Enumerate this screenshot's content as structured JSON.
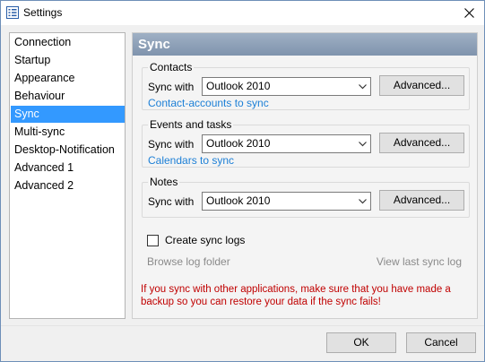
{
  "window": {
    "title": "Settings"
  },
  "nav": {
    "items": [
      {
        "label": "Connection"
      },
      {
        "label": "Startup"
      },
      {
        "label": "Appearance"
      },
      {
        "label": "Behaviour"
      },
      {
        "label": "Sync",
        "selected": true
      },
      {
        "label": "Multi-sync"
      },
      {
        "label": "Desktop-Notification"
      },
      {
        "label": "Advanced 1"
      },
      {
        "label": "Advanced 2"
      }
    ]
  },
  "panel": {
    "title": "Sync",
    "contacts": {
      "group_label": "Contacts",
      "sync_with_label": "Sync with",
      "selected_app": "Outlook 2010",
      "advanced_label": "Advanced...",
      "link": "Contact-accounts to sync"
    },
    "events": {
      "group_label": "Events and tasks",
      "sync_with_label": "Sync with",
      "selected_app": "Outlook 2010",
      "advanced_label": "Advanced...",
      "link": "Calendars to sync"
    },
    "notes": {
      "group_label": "Notes",
      "sync_with_label": "Sync with",
      "selected_app": "Outlook 2010",
      "advanced_label": "Advanced..."
    },
    "logs": {
      "checkbox_label": "Create sync logs",
      "checked": false,
      "browse_label": "Browse log folder",
      "view_label": "View last sync log"
    },
    "warning_line1": "If you sync with other applications, make sure that you have made a",
    "warning_line2": "backup so you can restore your data if the sync fails!"
  },
  "footer": {
    "ok_label": "OK",
    "cancel_label": "Cancel"
  },
  "colors": {
    "selection": "#3399ff",
    "link": "#1c7fd6",
    "warning": "#c00000",
    "header": "#8a9cb5"
  }
}
